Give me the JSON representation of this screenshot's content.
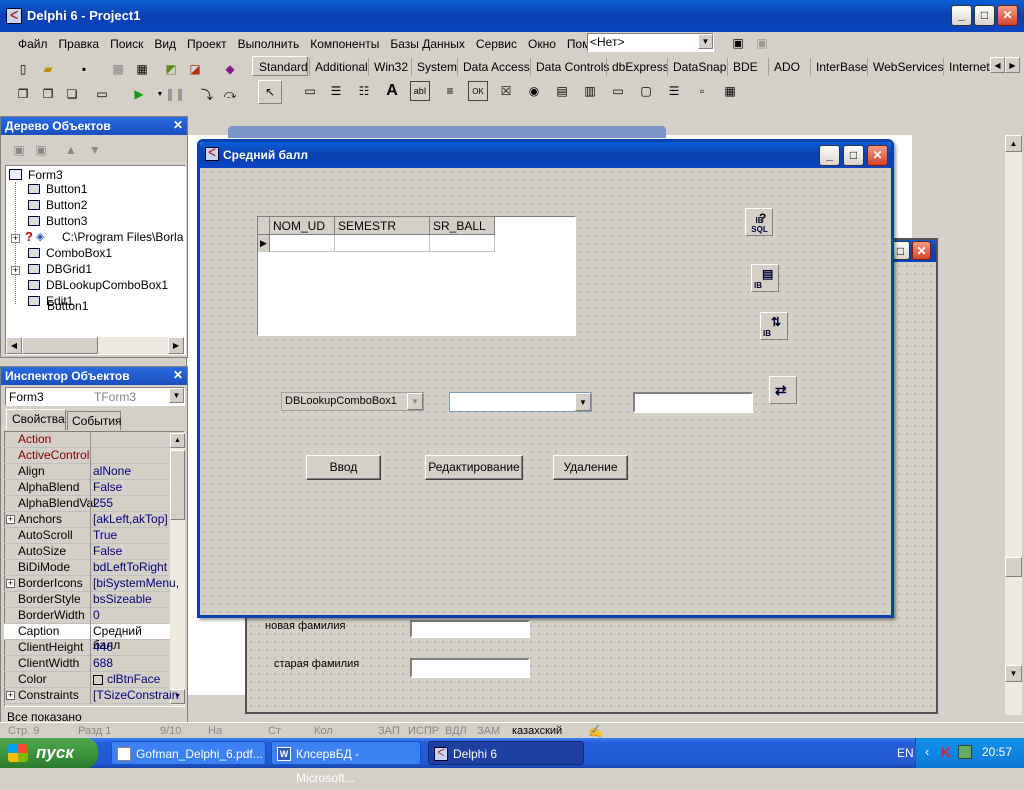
{
  "ide": {
    "title": "Delphi 6 - Project1",
    "menu": [
      "Файл",
      "Правка",
      "Поиск",
      "Вид",
      "Проект",
      "Выполнить",
      "Компоненты",
      "Базы Данных",
      "Сервис",
      "Окно",
      "Помощь"
    ],
    "desktop_combo": "<Нет>",
    "palette_tabs": [
      "Standard",
      "Additional",
      "Win32",
      "System",
      "Data Access",
      "Data Controls",
      "dbExpress",
      "DataSnap",
      "BDE",
      "ADO",
      "InterBase",
      "WebServices",
      "Internet"
    ]
  },
  "tree": {
    "title": "Дерево Объектов",
    "root": "Form3",
    "items": [
      "Button1",
      "Button2",
      "Button3",
      "C:\\Program Files\\Borland\\",
      "ComboBox1",
      "DBGrid1",
      "DBLookupComboBox1",
      "Edit1"
    ]
  },
  "inspector": {
    "title": "Инспектор Объектов",
    "object": "Form3",
    "type": "TForm3",
    "tabs": [
      "Свойства",
      "События"
    ],
    "rows": [
      {
        "name": "Action",
        "value": "",
        "red": true
      },
      {
        "name": "ActiveControl",
        "value": "",
        "red": true
      },
      {
        "name": "Align",
        "value": "alNone"
      },
      {
        "name": "AlphaBlend",
        "value": "False"
      },
      {
        "name": "AlphaBlendVal",
        "value": "255"
      },
      {
        "name": "Anchors",
        "value": "[akLeft,akTop]",
        "plus": true
      },
      {
        "name": "AutoScroll",
        "value": "True"
      },
      {
        "name": "AutoSize",
        "value": "False"
      },
      {
        "name": "BiDiMode",
        "value": "bdLeftToRight"
      },
      {
        "name": "BorderIcons",
        "value": "[biSystemMenu,",
        "plus": true
      },
      {
        "name": "BorderStyle",
        "value": "bsSizeable"
      },
      {
        "name": "BorderWidth",
        "value": "0"
      },
      {
        "name": "Caption",
        "value": "Средний балл",
        "sel": true
      },
      {
        "name": "ClientHeight",
        "value": "446"
      },
      {
        "name": "ClientWidth",
        "value": "688"
      },
      {
        "name": "Color",
        "value": "clBtnFace"
      },
      {
        "name": "Constraints",
        "value": "[TSizeConstrain",
        "plus": true
      }
    ],
    "status": "Все показано"
  },
  "form": {
    "title": "Средний балл",
    "grid_cols": [
      "NOM_UD",
      "SEMESTR",
      "SR_BALL"
    ],
    "lookup_text": "DBLookupComboBox1",
    "btn_input": "Ввод",
    "btn_edit": "Редактирование",
    "btn_delete": "Удаление",
    "ib_sql": "IB SQL",
    "ib": "IB"
  },
  "backform": {
    "label_new": "новая фамилия",
    "label_old": "старая фамилия"
  },
  "statusbar": {
    "line": "Стр. 9",
    "section": "Разд 1",
    "pages": "9/10",
    "at": "На",
    "st": "Ст",
    "col": "Кол",
    "zap": "ЗАП",
    "ispr": "ИСПР",
    "vdl": "ВДЛ",
    "zam": "ЗАМ",
    "lang": "казахский"
  },
  "taskbar": {
    "start": "пуск",
    "items": [
      "Gofman_Delphi_6.pdf...",
      "КлсервБД - Microsoft...",
      "Delphi 6"
    ],
    "lang": "EN",
    "time": "20:57"
  }
}
